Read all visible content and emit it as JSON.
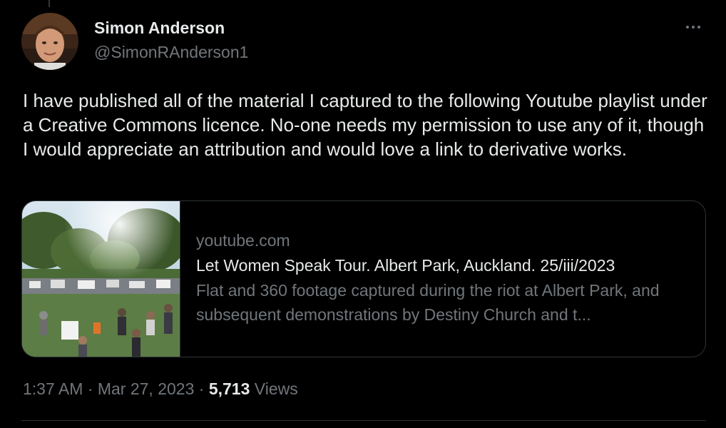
{
  "tweet": {
    "author": {
      "display_name": "Simon Anderson",
      "handle": "@SimonRAnderson1"
    },
    "more_icon": "more-horizontal-icon",
    "text": "I have published all of the material I captured to the following Youtube playlist under a Creative Commons licence. No-one needs my permission to use any of it, though I would appreciate an attribution and would love a link to derivative works.",
    "link_card": {
      "domain": "youtube.com",
      "title": "Let Women Speak Tour. Albert Park, Auckland. 25/iii/2023",
      "description": "Flat and 360 footage captured during the riot at Albert Park, and subsequent demonstrations by Destiny Church and t..."
    },
    "meta": {
      "time": "1:37 AM",
      "separator": "·",
      "date": "Mar 27, 2023",
      "views_count": "5,713",
      "views_label": "Views"
    }
  },
  "colors": {
    "background": "#000000",
    "primary_text": "#e7e9ea",
    "secondary_text": "#71767b",
    "border": "#2f3336"
  }
}
